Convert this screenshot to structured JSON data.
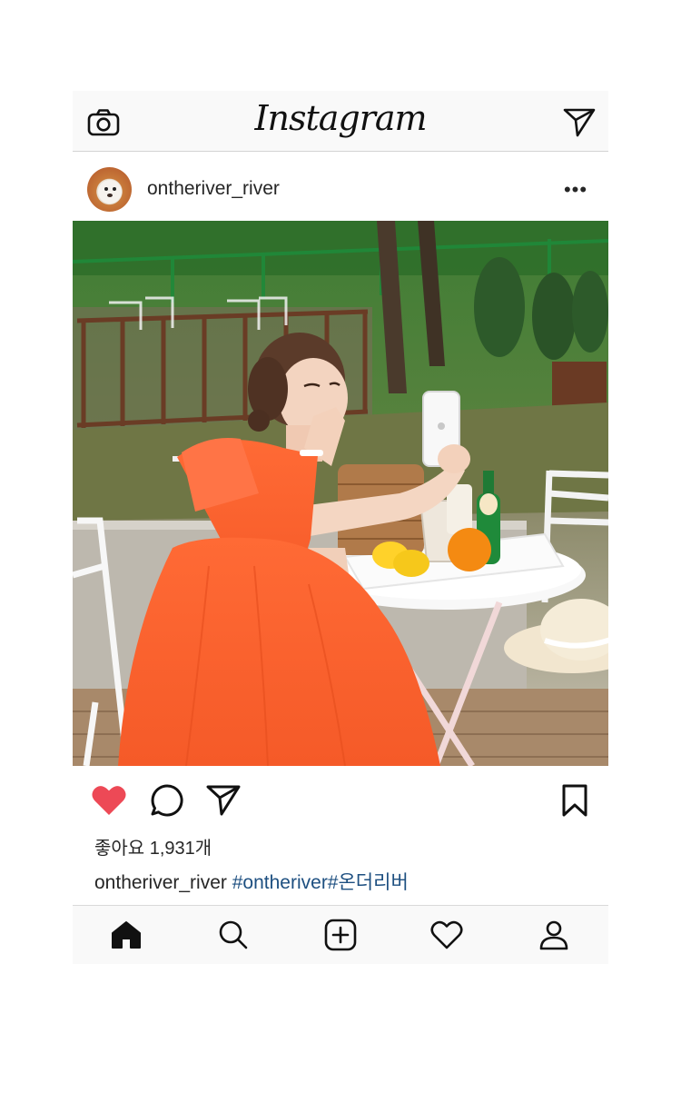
{
  "app": {
    "brand": "Instagram"
  },
  "top_bar": {
    "left_icon": "camera-icon",
    "right_icon": "direct-send-icon"
  },
  "post": {
    "username": "ontheriver_river",
    "menu_icon": "more-options-icon",
    "more_label": "•••",
    "image_description_icon": "photo",
    "likes_text": "좋아요 1,931개",
    "caption_username": "ontheriver_river",
    "caption_tags": "#ontheriver#온더리버",
    "liked": true,
    "colors": {
      "like_red": "#ed4956",
      "hashtag_blue": "#1d4f80",
      "text": "#262626"
    }
  },
  "action_icons": [
    "heart-icon",
    "comment-icon",
    "share-icon",
    "bookmark-icon"
  ],
  "bottom_nav": {
    "items": [
      "home-icon",
      "search-icon",
      "add-post-icon",
      "activity-heart-icon",
      "profile-icon"
    ],
    "active": "home-icon"
  }
}
